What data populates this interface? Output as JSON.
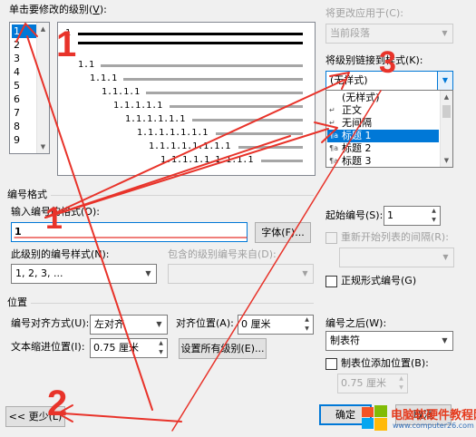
{
  "level_section": {
    "label_prefix": "单击要修改的级别(",
    "label_key": "V",
    "label_suffix": "):",
    "levels": [
      "1",
      "2",
      "3",
      "4",
      "5",
      "6",
      "7",
      "8",
      "9"
    ],
    "selected": "1"
  },
  "preview": {
    "rows": [
      "1",
      "1.1",
      "1.1.1",
      "1.1.1.1",
      "1.1.1.1.1",
      "1.1.1.1.1.1",
      "1.1.1.1.1.1.1",
      "1.1.1.1.1.1.1.1",
      "1.1.1.1.1.1.1.1.1"
    ]
  },
  "apply_to": {
    "label": "将更改应用于(C):",
    "value": "当前段落"
  },
  "link_style": {
    "label": "将级别链接到样式(K):",
    "value": "(无样式)",
    "options": [
      {
        "icon": "",
        "text": "(无样式)"
      },
      {
        "icon": "↵",
        "text": "正文"
      },
      {
        "icon": "↵",
        "text": "无间隔"
      },
      {
        "icon": "¶a",
        "text": "标题 1"
      },
      {
        "icon": "¶a",
        "text": "标题 2"
      },
      {
        "icon": "¶a",
        "text": "标题 3"
      }
    ],
    "selected_index": 3
  },
  "number_format": {
    "section_title": "编号格式",
    "input_label": "输入编号的格式(O):",
    "input_value": "1",
    "font_button": "字体(F)...",
    "style_label": "此级别的编号样式(N):",
    "style_value": "1, 2, 3, ...",
    "include_label": "包含的级别编号来自(D):",
    "include_value": ""
  },
  "start": {
    "label": "起始编号(S):",
    "value": "1",
    "restart_label": "重新开始列表的间隔(R):",
    "restart_value": "",
    "legal_label": "正规形式编号(G)"
  },
  "position": {
    "section_title": "位置",
    "align_label": "编号对齐方式(U):",
    "align_value": "左对齐",
    "align_at_label": "对齐位置(A):",
    "align_at_value": "0 厘米",
    "indent_label": "文本缩进位置(I):",
    "indent_value": "0.75 厘米",
    "set_all_button": "设置所有级别(E)...",
    "follow_label": "编号之后(W):",
    "follow_value": "制表符",
    "tab_add_label": "制表位添加位置(B):",
    "tab_add_value": "0.75 厘米"
  },
  "footer": {
    "less_button": "<< 更少(L)",
    "ok_button": "确定",
    "cancel_button": "取消"
  },
  "annotations": {
    "n1": "1",
    "n2": "2",
    "n3": "3",
    "color": "#e8332a"
  },
  "watermark": {
    "title": "电脑软硬件教程网",
    "url": "www.computer26.com"
  }
}
